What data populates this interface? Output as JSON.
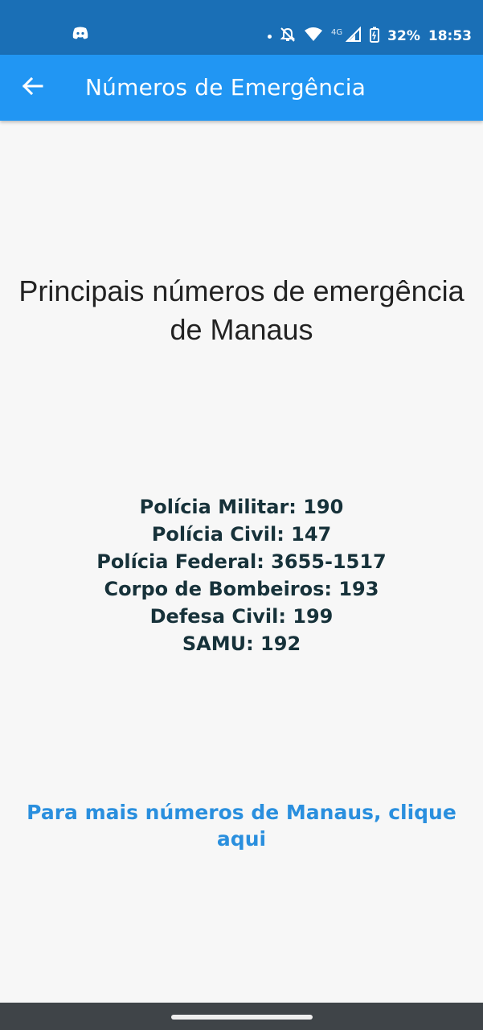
{
  "status_bar": {
    "battery": "32%",
    "time": "18:53",
    "network": "4G",
    "icons": [
      "discord-icon",
      "notification-dot-icon",
      "mute-icon",
      "wifi-icon",
      "signal-icon",
      "battery-icon"
    ]
  },
  "app_bar": {
    "title": "Números de Emergência",
    "back_icon": "arrow-back-icon"
  },
  "main": {
    "heading": "Principais números de emergência de Manaus",
    "numbers": [
      "Polícia Militar: 190",
      "Polícia Civil: 147",
      "Polícia Federal: 3655-1517",
      "Corpo de Bombeiros: 193",
      "Defesa Civil: 199",
      "SAMU: 192"
    ],
    "more_link": "Para mais números de Manaus, clique aqui"
  },
  "colors": {
    "status_bar": "#1a6fb6",
    "app_bar": "#2196f3",
    "background": "#f7f7f7",
    "numbers_text": "#17323a",
    "link": "#2a8fde",
    "nav_bar": "#3f4448"
  }
}
